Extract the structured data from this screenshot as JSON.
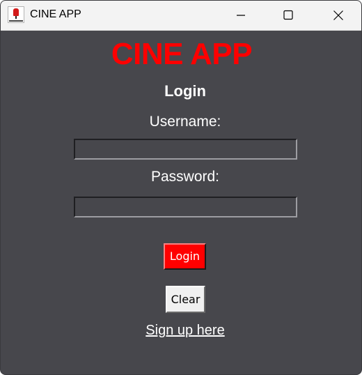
{
  "window": {
    "title": "CINE APP",
    "controls": {
      "minimize_icon": "minimize-icon",
      "maximize_icon": "maximize-icon",
      "close_icon": "close-icon"
    }
  },
  "app": {
    "heading": "CINE APP",
    "heading_color": "#ff0000",
    "background_color": "#47474c"
  },
  "login": {
    "title": "Login",
    "username_label": "Username:",
    "username_value": "",
    "password_label": "Password:",
    "password_value": "",
    "login_button": "Login",
    "login_button_color": "#ff0000",
    "clear_button": "Clear",
    "signup_link": "Sign up here"
  }
}
